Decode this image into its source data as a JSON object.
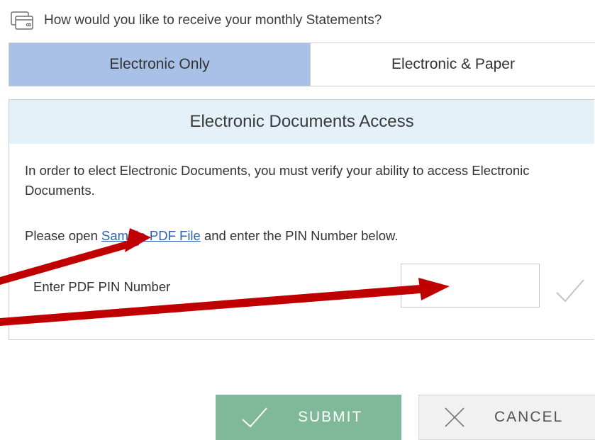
{
  "question": {
    "icon": "card-statement-icon",
    "text": "How would you like to receive your monthly Statements?"
  },
  "tabs": [
    {
      "label": "Electronic Only",
      "active": true
    },
    {
      "label": "Electronic & Paper",
      "active": false
    }
  ],
  "panel": {
    "title": "Electronic Documents Access",
    "paragraph1": "In order to elect Electronic Documents, you must verify your ability to access Electronic Documents.",
    "paragraph2_before": "Please open ",
    "link_text": "Sample PDF File",
    "paragraph2_after": " and enter the PIN Number below.",
    "pin_label": "Enter PDF PIN Number",
    "pin_value": "",
    "pin_check_icon": "checkmark-icon"
  },
  "buttons": {
    "submit_label": "SUBMIT",
    "submit_icon": "checkmark-icon",
    "cancel_label": "CANCEL",
    "cancel_icon": "close-x-icon"
  },
  "colors": {
    "active_tab": "#a9c1e6",
    "panel_header": "#e4f1f9",
    "link": "#2f63b3",
    "submit_bg": "#7fb99a",
    "cancel_bg": "#f1f1f1",
    "annotation_arrow": "#c00000"
  },
  "annotations": {
    "arrow_icon": "red-arrow-icon"
  }
}
